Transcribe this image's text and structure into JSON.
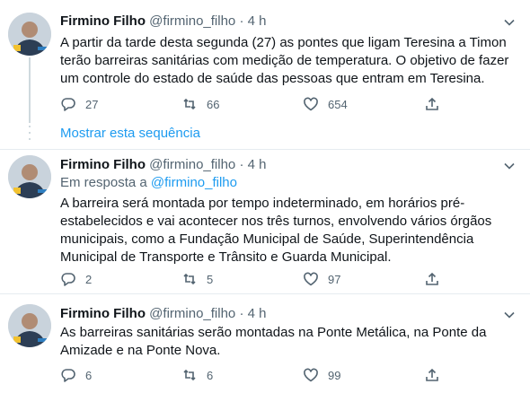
{
  "tweets": [
    {
      "name": "Firmino Filho",
      "handle": "@firmino_filho",
      "separator": "·",
      "time": "4 h",
      "text": "A partir da tarde desta segunda (27) as pontes que ligam Teresina a Timon terão barreiras sanitárias com medição de temperatura. O objetivo de fazer um controle do estado de saúde das pessoas que entram em Teresina.",
      "replies": "27",
      "retweets": "66",
      "likes": "654"
    },
    {
      "name": "Firmino Filho",
      "handle": "@firmino_filho",
      "separator": "·",
      "time": "4 h",
      "reply_prefix": "Em resposta a",
      "reply_mention": "@firmino_filho",
      "text": "A barreira será montada por tempo indeterminado, em horários pré-estabelecidos e vai acontecer nos três turnos, envolvendo vários órgãos municipais, como a Fundação Municipal de Saúde, Superintendência Municipal de Transporte e Trânsito e Guarda Municipal.",
      "replies": "2",
      "retweets": "5",
      "likes": "97"
    },
    {
      "name": "Firmino Filho",
      "handle": "@firmino_filho",
      "separator": "·",
      "time": "4 h",
      "text": "As barreiras sanitárias serão montadas na Ponte Metálica, na Ponte da Amizade e na Ponte Nova.",
      "replies": "6",
      "retweets": "6",
      "likes": "99"
    }
  ],
  "show_thread_label": "Mostrar esta sequência",
  "icons": {
    "reply": "reply-icon",
    "retweet": "retweet-icon",
    "like": "heart-icon",
    "share": "share-icon",
    "menu": "chevron-down-icon"
  },
  "colors": {
    "link": "#1d9bf0",
    "secondary_text": "#536471",
    "divider": "#e6ecf0"
  }
}
